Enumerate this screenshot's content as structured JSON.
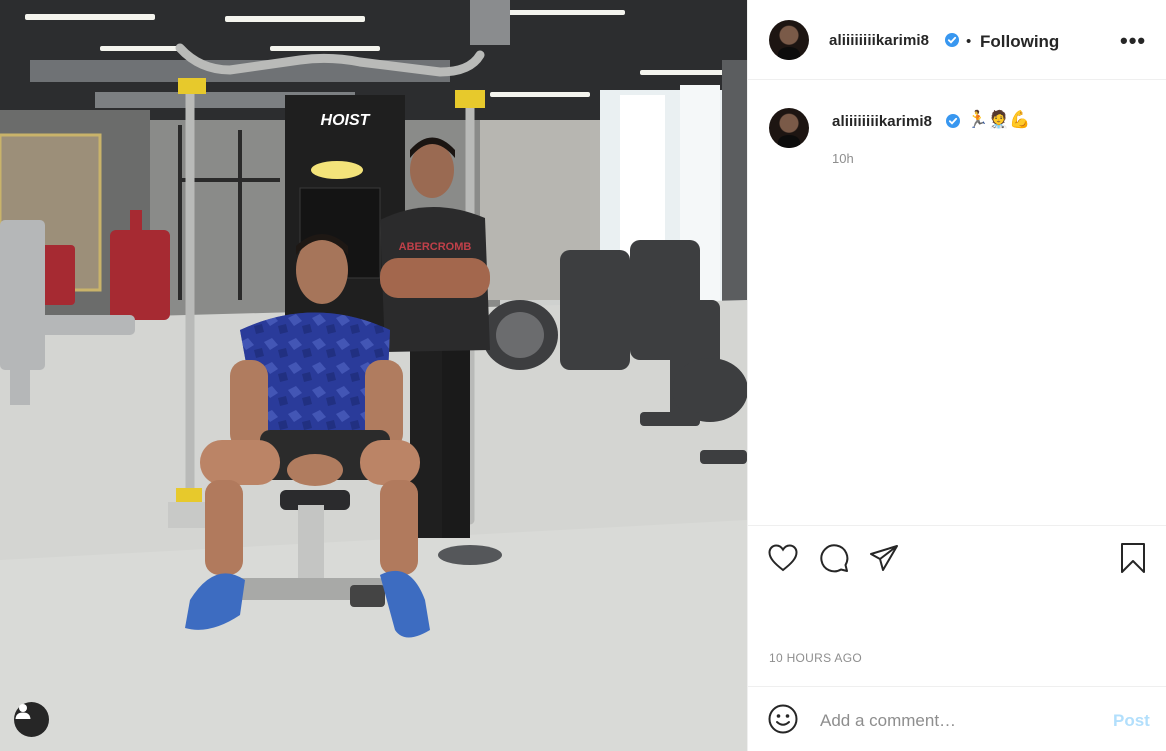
{
  "post": {
    "username": "aliiiiiiiikarimi8",
    "follow_status": "Following",
    "separator": "•",
    "more_label": "•••",
    "caption_emojis": "🏃🧑‍⚕️💪",
    "posted_relative": "10h",
    "timestamp": "10 HOURS AGO",
    "verified": true
  },
  "photo": {
    "brand_text": "HOIST"
  },
  "actions": {
    "icons": [
      "heart-icon",
      "comment-icon",
      "share-icon",
      "bookmark-icon"
    ]
  },
  "comment": {
    "placeholder": "Add a comment…",
    "post_label": "Post",
    "emoji_icon": "smiley-icon"
  },
  "colors": {
    "verified_blue": "#3897f0",
    "post_disabled": "#b2dffc",
    "muted_text": "#8e8e8e",
    "primary_text": "#262626"
  }
}
